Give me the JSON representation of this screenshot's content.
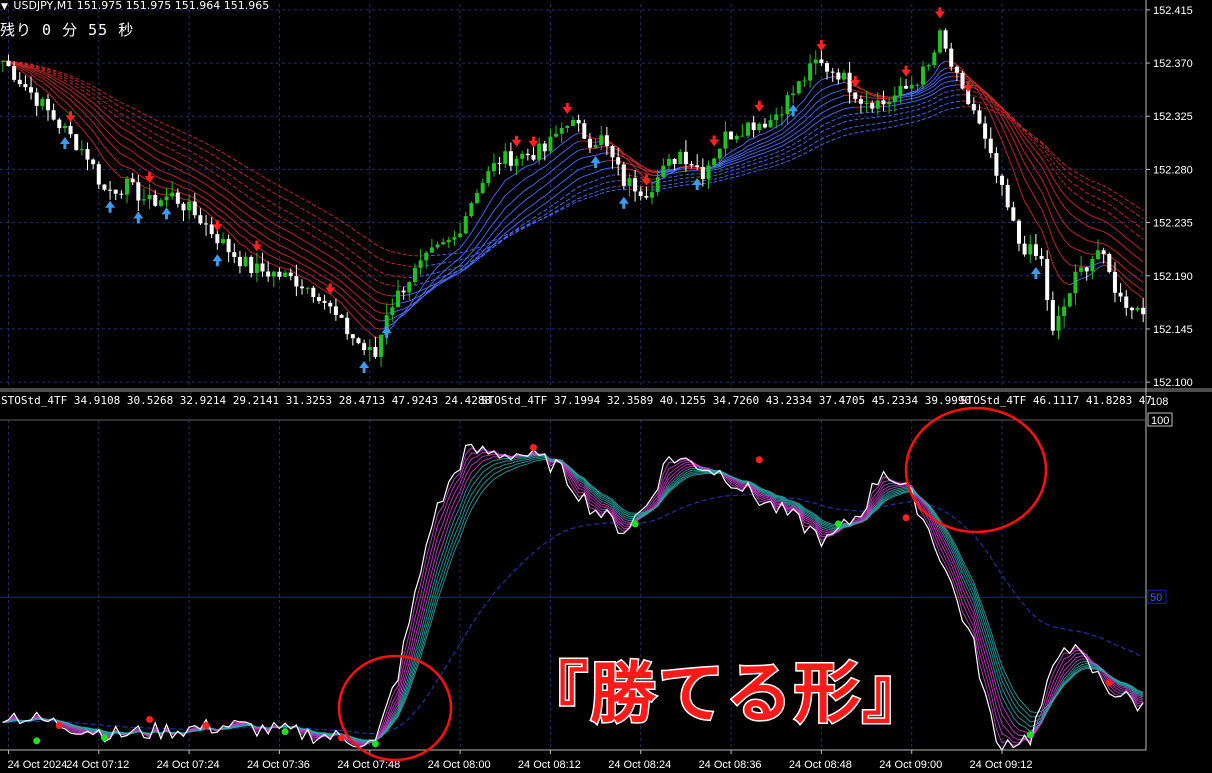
{
  "header": {
    "symbol_line": "USDJPY,M1  151.975 151.975 151.964 151.965",
    "timer_label": "残り 0 分 55 秒"
  },
  "price_axis": {
    "ticks": [
      "152.415",
      "152.370",
      "152.325",
      "152.280",
      "152.235",
      "152.190",
      "152.145",
      "152.100"
    ],
    "max_label": "152.415"
  },
  "osc_axis": {
    "top_label": "108",
    "level_100": "100",
    "level_50": "50"
  },
  "osc_header": [
    "STOStd_4TF 34.9108 30.5268 32.9214 29.2141 31.3253 28.4713 47.9243 24.4288",
    "STOStd_4TF 37.1994 32.3589 40.1255 34.7260 43.2334 37.4705 45.2334 39.9990",
    "STOStd_4TF 46.1117 41.8283 47"
  ],
  "time_axis": {
    "labels": [
      "24 Oct 2024",
      "24 Oct 07:12",
      "24 Oct 07:24",
      "24 Oct 07:36",
      "24 Oct 07:48",
      "24 Oct 08:00",
      "24 Oct 08:12",
      "24 Oct 08:24",
      "24 Oct 08:36",
      "24 Oct 08:48",
      "24 Oct 09:00",
      "24 Oct 09:12"
    ]
  },
  "caption": "『勝てる形』",
  "colors": {
    "background": "#000000",
    "grid": "#1c2f70",
    "bull_candle": "#22c022",
    "bear_candle": "#ffffff",
    "buy_arrow": "#3a9cf0",
    "sell_arrow": "#ff2020",
    "ema_red": "#d02828",
    "ema_blue": "#4c6cff",
    "sto_main": "#ffffff",
    "sto_magenta": "#d040d0",
    "sto_teal": "#2aa8a8",
    "level50": "#1a1ad8",
    "caption": "#ff1a1a",
    "circle": "#ff1010"
  },
  "chart_data": [
    {
      "type": "candlestick",
      "symbol": "USDJPY",
      "timeframe": "M1",
      "ylim": [
        152.095,
        152.42
      ],
      "close_path": [
        [
          0,
          152.372
        ],
        [
          5,
          152.345
        ],
        [
          10,
          152.318
        ],
        [
          15,
          152.292
        ],
        [
          18,
          152.262
        ],
        [
          22,
          152.266
        ],
        [
          26,
          152.252
        ],
        [
          30,
          152.258
        ],
        [
          35,
          152.238
        ],
        [
          40,
          152.212
        ],
        [
          44,
          152.196
        ],
        [
          48,
          152.192
        ],
        [
          52,
          152.186
        ],
        [
          56,
          152.175
        ],
        [
          60,
          152.148
        ],
        [
          64,
          152.128
        ],
        [
          66,
          152.122
        ],
        [
          68,
          152.16
        ],
        [
          72,
          152.188
        ],
        [
          76,
          152.208
        ],
        [
          80,
          152.222
        ],
        [
          84,
          152.264
        ],
        [
          88,
          152.288
        ],
        [
          92,
          152.292
        ],
        [
          96,
          152.296
        ],
        [
          100,
          152.322
        ],
        [
          104,
          152.305
        ],
        [
          106,
          152.306
        ],
        [
          110,
          152.27
        ],
        [
          114,
          152.262
        ],
        [
          120,
          152.295
        ],
        [
          124,
          152.278
        ],
        [
          128,
          152.308
        ],
        [
          132,
          152.318
        ],
        [
          136,
          152.322
        ],
        [
          140,
          152.345
        ],
        [
          144,
          152.37
        ],
        [
          148,
          152.362
        ],
        [
          152,
          152.34
        ],
        [
          156,
          152.336
        ],
        [
          160,
          152.348
        ],
        [
          164,
          152.366
        ],
        [
          166,
          152.392
        ],
        [
          170,
          152.343
        ],
        [
          172,
          152.33
        ],
        [
          176,
          152.274
        ],
        [
          180,
          152.218
        ],
        [
          184,
          152.202
        ],
        [
          186,
          152.14
        ],
        [
          190,
          152.188
        ],
        [
          194,
          152.212
        ],
        [
          198,
          152.17
        ],
        [
          202,
          152.16
        ]
      ]
    },
    {
      "type": "line",
      "name": "STOStd_4TF",
      "ylim": [
        0,
        108
      ],
      "levels": [
        50,
        100
      ],
      "x": [
        0,
        20,
        40,
        50,
        60,
        66,
        70,
        76,
        82,
        88,
        92,
        98,
        104,
        110,
        114,
        118,
        124,
        128,
        134,
        140,
        146,
        152,
        156,
        160,
        162,
        166,
        172,
        176,
        182,
        188,
        192,
        196,
        202
      ],
      "main": [
        12,
        5,
        8,
        6,
        4,
        2,
        25,
        75,
        98,
        97,
        97,
        93,
        80,
        72,
        80,
        96,
        93,
        90,
        82,
        76,
        68,
        78,
        92,
        85,
        80,
        64,
        34,
        2,
        4,
        36,
        28,
        20,
        14
      ],
      "markers": [
        {
          "x": 6,
          "y": 3,
          "color": "green"
        },
        {
          "x": 10,
          "y": 8,
          "color": "red"
        },
        {
          "x": 18,
          "y": 4,
          "color": "green"
        },
        {
          "x": 26,
          "y": 10,
          "color": "red"
        },
        {
          "x": 36,
          "y": 8,
          "color": "red"
        },
        {
          "x": 50,
          "y": 6,
          "color": "green"
        },
        {
          "x": 60,
          "y": 4,
          "color": "red"
        },
        {
          "x": 66,
          "y": 2,
          "color": "green"
        },
        {
          "x": 94,
          "y": 99,
          "color": "red"
        },
        {
          "x": 112,
          "y": 74,
          "color": "green"
        },
        {
          "x": 134,
          "y": 95,
          "color": "red"
        },
        {
          "x": 148,
          "y": 74,
          "color": "green"
        },
        {
          "x": 160,
          "y": 76,
          "color": "red"
        },
        {
          "x": 182,
          "y": 5,
          "color": "green"
        },
        {
          "x": 196,
          "y": 22,
          "color": "red"
        }
      ]
    }
  ]
}
